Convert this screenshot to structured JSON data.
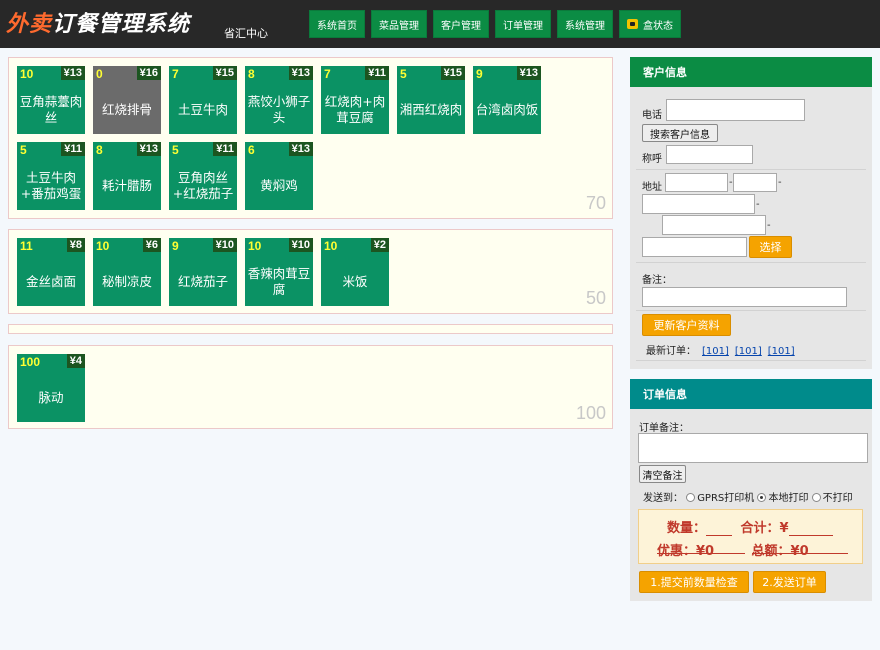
{
  "app": {
    "logo_a": "外卖",
    "logo_b": "订餐管理系统",
    "subtitle": "省汇中心"
  },
  "nav": {
    "home": "系统首页",
    "dishes": "菜品管理",
    "customers": "客户管理",
    "orders": "订单管理",
    "system": "系统管理",
    "box_status": "盒状态"
  },
  "categories": [
    {
      "total": "70",
      "dishes": [
        {
          "stock": "10",
          "price": "¥13",
          "name": "豆角蒜薹肉丝",
          "sold_out": false
        },
        {
          "stock": "0",
          "price": "¥16",
          "name": "红烧排骨",
          "sold_out": true
        },
        {
          "stock": "7",
          "price": "¥15",
          "name": "土豆牛肉",
          "sold_out": false
        },
        {
          "stock": "8",
          "price": "¥13",
          "name": "燕饺小狮子头",
          "sold_out": false
        },
        {
          "stock": "7",
          "price": "¥11",
          "name": "红烧肉+肉茸豆腐",
          "sold_out": false
        },
        {
          "stock": "5",
          "price": "¥15",
          "name": "湘西红烧肉",
          "sold_out": false
        },
        {
          "stock": "9",
          "price": "¥13",
          "name": "台湾卤肉饭",
          "sold_out": false
        },
        {
          "stock": "5",
          "price": "¥11",
          "name": "土豆牛肉+番茄鸡蛋",
          "sold_out": false
        },
        {
          "stock": "8",
          "price": "¥13",
          "name": "耗汁腊肠",
          "sold_out": false
        },
        {
          "stock": "5",
          "price": "¥11",
          "name": "豆角肉丝+红烧茄子",
          "sold_out": false
        },
        {
          "stock": "6",
          "price": "¥13",
          "name": "黄焖鸡",
          "sold_out": false
        }
      ]
    },
    {
      "total": "50",
      "dishes": [
        {
          "stock": "11",
          "price": "¥8",
          "name": "金丝卤面",
          "sold_out": false
        },
        {
          "stock": "10",
          "price": "¥6",
          "name": "秘制凉皮",
          "sold_out": false
        },
        {
          "stock": "9",
          "price": "¥10",
          "name": "红烧茄子",
          "sold_out": false
        },
        {
          "stock": "10",
          "price": "¥10",
          "name": "香辣肉茸豆腐",
          "sold_out": false
        },
        {
          "stock": "10",
          "price": "¥2",
          "name": "米饭",
          "sold_out": false
        }
      ]
    },
    {
      "total": "",
      "dishes": []
    },
    {
      "total": "100",
      "dishes": [
        {
          "stock": "100",
          "price": "¥4",
          "name": "脉动",
          "sold_out": false
        }
      ]
    }
  ],
  "customer": {
    "title": "客户信息",
    "phone_label": "电话",
    "phone_value": "",
    "search_button": "搜索客户信息",
    "name_label": "称呼",
    "name_value": "",
    "address_label": "地址",
    "dash": "-",
    "select_button": "选择",
    "note_label": "备注：",
    "note_value": "",
    "update_button": "更新客户资料",
    "recent_label": "最新订单：",
    "recent_orders": [
      "[101]",
      "[101]",
      "[101]"
    ]
  },
  "order": {
    "title": "订单信息",
    "note_label": "订单备注：",
    "note_value": "",
    "clear_button": "清空备注",
    "send_to_label": "发送到：",
    "options": [
      {
        "label": "GPRS打印机",
        "selected": false
      },
      {
        "label": "本地打印",
        "selected": true
      },
      {
        "label": "不打印",
        "selected": false
      }
    ],
    "qty_label": "数量：",
    "qty_value": "",
    "sum_label": "合计：¥",
    "sum_value": "",
    "discount_label": "优惠：¥0",
    "total_label": "总额：¥0",
    "check_button": "1.提交前数量检查",
    "send_button": "2.发送订单"
  },
  "colors": {
    "header_bg": "#282828",
    "nav_green": "#0b8c44",
    "dish_green": "#0b9264",
    "sold_out_grey": "#6b6b6b",
    "customer_head": "#0b8c44",
    "order_head": "#008b8b",
    "orange_button": "#f5a300"
  },
  "icons": {
    "box_status": "phone-icon"
  }
}
